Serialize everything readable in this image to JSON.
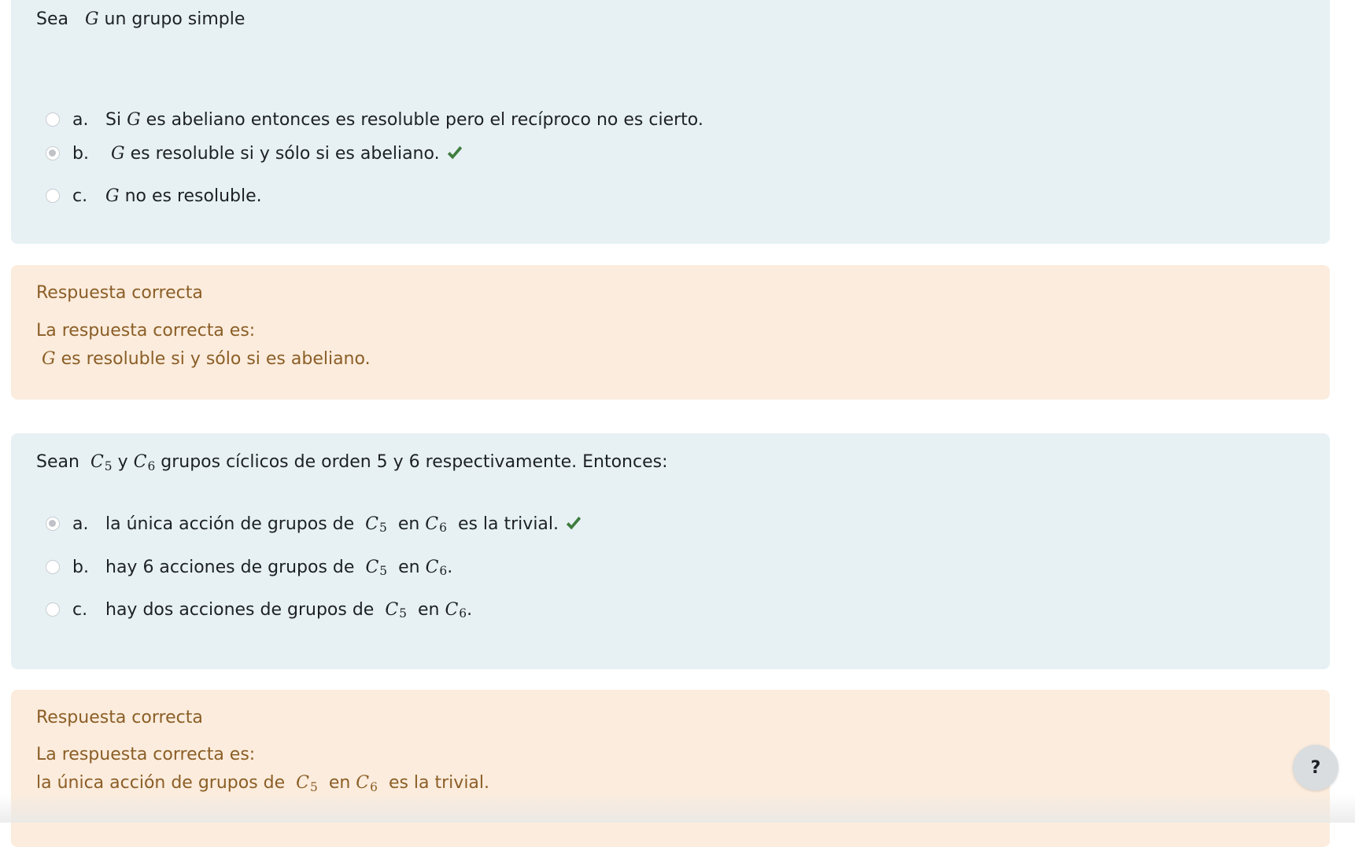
{
  "questions": [
    {
      "prompt": {
        "pre": "Sea",
        "var": "G",
        "post": "un grupo simple"
      },
      "options": [
        {
          "letter": "a.",
          "parts": {
            "t1": "Si",
            "m1": "G",
            "t2": "es abeliano entonces es resoluble pero el recíproco no es cierto."
          },
          "selected": false,
          "correct": false
        },
        {
          "letter": "b.",
          "parts": {
            "m1": "G",
            "t1": "es resoluble si y sólo si es abeliano."
          },
          "selected": true,
          "correct": true
        },
        {
          "letter": "c.",
          "parts": {
            "m1": "G",
            "t1": "no es resoluble."
          },
          "selected": false,
          "correct": false
        }
      ],
      "feedback": {
        "status": "Respuesta correcta",
        "intro": "La respuesta correcta es:",
        "answer": {
          "m1": "G",
          "t1": "es resoluble si y sólo si es abeliano."
        }
      }
    },
    {
      "prompt": {
        "pre": "Sean",
        "m1": "C",
        "s1": "5",
        "mid": "y",
        "m2": "C",
        "s2": "6",
        "post": "grupos cíclicos de orden 5 y 6 respectivamente. Entonces:"
      },
      "options": [
        {
          "letter": "a.",
          "parts": {
            "t1": "la única acción de grupos de",
            "m1": "C",
            "s1": "5",
            "t2": "en",
            "m2": "C",
            "s2": "6",
            "t3": "es la trivial."
          },
          "selected": true,
          "correct": true
        },
        {
          "letter": "b.",
          "parts": {
            "t1": "hay 6 acciones de grupos de",
            "m1": "C",
            "s1": "5",
            "t2": "en",
            "m2": "C",
            "s2": "6",
            "t3": "."
          },
          "selected": false,
          "correct": false
        },
        {
          "letter": "c.",
          "parts": {
            "t1": "hay dos acciones de grupos de",
            "m1": "C",
            "s1": "5",
            "t2": "en",
            "m2": "C",
            "s2": "6",
            "t3": "."
          },
          "selected": false,
          "correct": false
        }
      ],
      "feedback": {
        "status": "Respuesta correcta",
        "intro": "La respuesta correcta es:",
        "answer": {
          "t1": "la única acción de grupos de",
          "m1": "C",
          "s1": "5",
          "t2": "en",
          "m2": "C",
          "s2": "6",
          "t3": "es la trivial."
        }
      }
    }
  ],
  "help_button": {
    "label": "?"
  },
  "colors": {
    "formulation_bg": "#e7f1f4",
    "feedback_bg": "#fbecdd",
    "feedback_text": "#8b5e26",
    "check": "#3f7d3f"
  },
  "icons": {
    "correct": "check-icon",
    "help": "question-mark-icon"
  }
}
